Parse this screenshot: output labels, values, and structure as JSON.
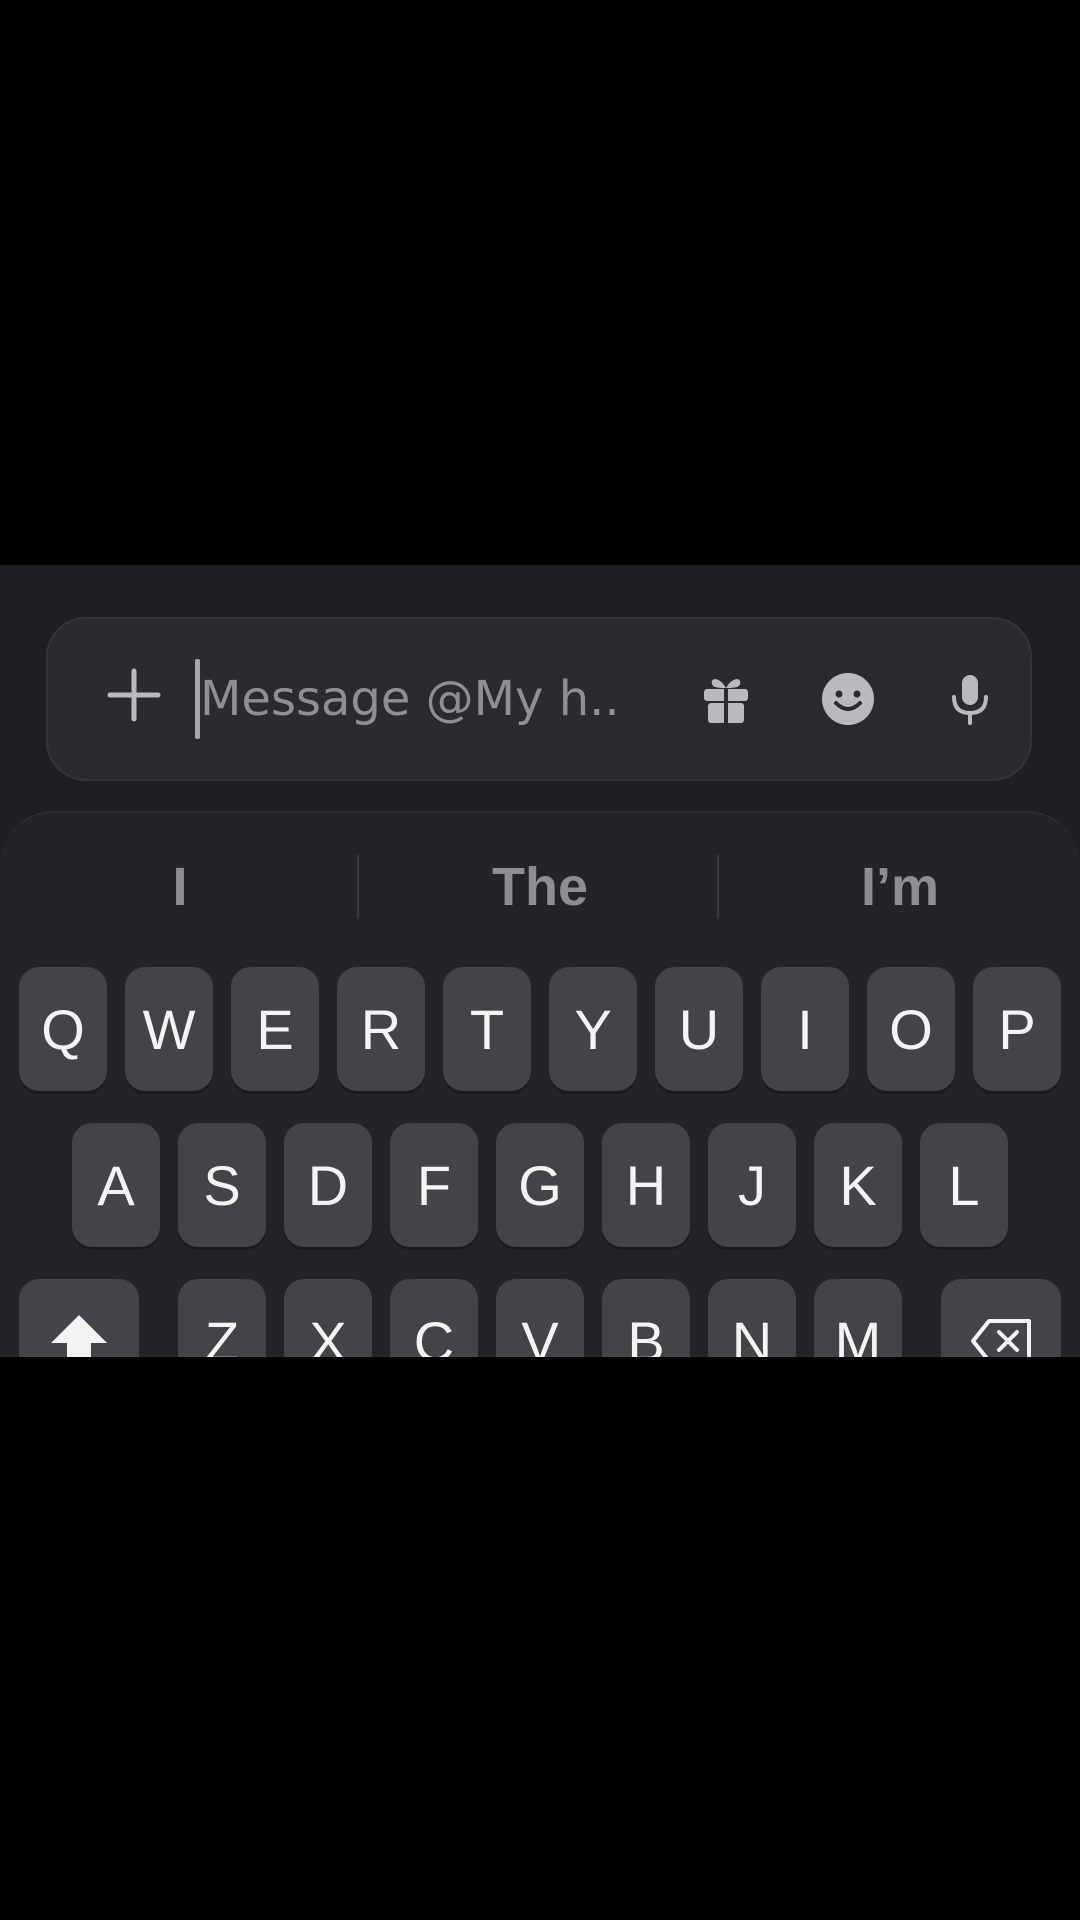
{
  "composer": {
    "placeholder": "Message @My h...",
    "value": "",
    "icons": {
      "add": "plus-icon",
      "gift": "gift-icon",
      "emoji": "emoji-icon",
      "mic": "microphone-icon"
    }
  },
  "keyboard": {
    "suggestions": [
      "I",
      "The",
      "I’m"
    ],
    "row1": [
      "Q",
      "W",
      "E",
      "R",
      "T",
      "Y",
      "U",
      "I",
      "O",
      "P"
    ],
    "row2": [
      "A",
      "S",
      "D",
      "F",
      "G",
      "H",
      "J",
      "K",
      "L"
    ],
    "row3": [
      "Z",
      "X",
      "C",
      "V",
      "B",
      "N",
      "M"
    ],
    "special": {
      "shift": "shift-icon",
      "backspace": "backspace-icon"
    }
  },
  "colors": {
    "background": "#000000",
    "app_background": "#1e1f23",
    "composer_background": "#2a2b30",
    "key_background": "#434447",
    "key_text": "#f4f4f5",
    "placeholder": "#8e8f95",
    "suggestion_text": "#8d8e92"
  }
}
